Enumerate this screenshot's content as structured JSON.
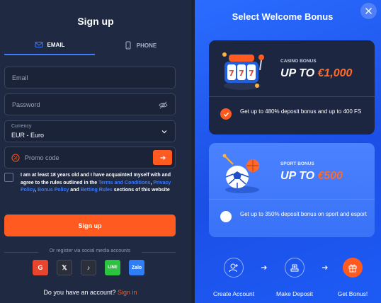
{
  "signup": {
    "title": "Sign up",
    "tabs": [
      {
        "label": "EMAIL",
        "icon": "mail-icon"
      },
      {
        "label": "PHONE",
        "icon": "phone-icon"
      }
    ],
    "email_placeholder": "Email",
    "password_placeholder": "Password",
    "currency_label": "Currency",
    "currency_value": "EUR - Euro",
    "promo_placeholder": "Promo code",
    "terms": {
      "prefix": "I am at least 18 years old and I have acquainted myself with and agree to the rules outlined in the",
      "terms_link": "Terms and Conditions",
      "privacy_link": "Privacy Policy",
      "bonus_link": "Bonus Policy",
      "and1": "and",
      "betting_link": "Betting Rules",
      "suffix": "sections of this website"
    },
    "submit_label": "Sign up",
    "social_label": "Or register via social media accounts",
    "socials": [
      {
        "name": "google",
        "label": "G",
        "color": "#e8452f"
      },
      {
        "name": "x",
        "label": "𝕏",
        "color": "#2b2f3a"
      },
      {
        "name": "tiktok",
        "label": "♪",
        "color": "#2b2f3a"
      },
      {
        "name": "line",
        "label": "LINE",
        "color": "#2bc33f"
      },
      {
        "name": "zalo",
        "label": "Zalo",
        "color": "#2f7ef5"
      }
    ],
    "account_question": "Do you have an account?",
    "signin_link": "Sign in"
  },
  "bonus": {
    "title": "Select Welcome Bonus",
    "cards": [
      {
        "category": "CASINO BONUS",
        "amount_prefix": "UP TO ",
        "amount_value": "€1,000",
        "description": "Get up to 480% deposit bonus and up to 400 FS",
        "selected": true
      },
      {
        "category": "SPORT BONUS",
        "amount_prefix": "UP TO ",
        "amount_value": "€500",
        "description": "Get up to 350% deposit bonus on sport and esport",
        "selected": false
      }
    ],
    "steps": [
      {
        "label": "Create Account",
        "icon": "user-add-icon"
      },
      {
        "label": "Make Deposit",
        "icon": "deposit-icon"
      },
      {
        "label": "Get Bonus!",
        "icon": "gift-icon"
      }
    ]
  },
  "colors": {
    "accent": "#ff5a1f",
    "link": "#3d7bff",
    "panel": "#1f2942",
    "bonus_bg": "#2b6cff"
  }
}
